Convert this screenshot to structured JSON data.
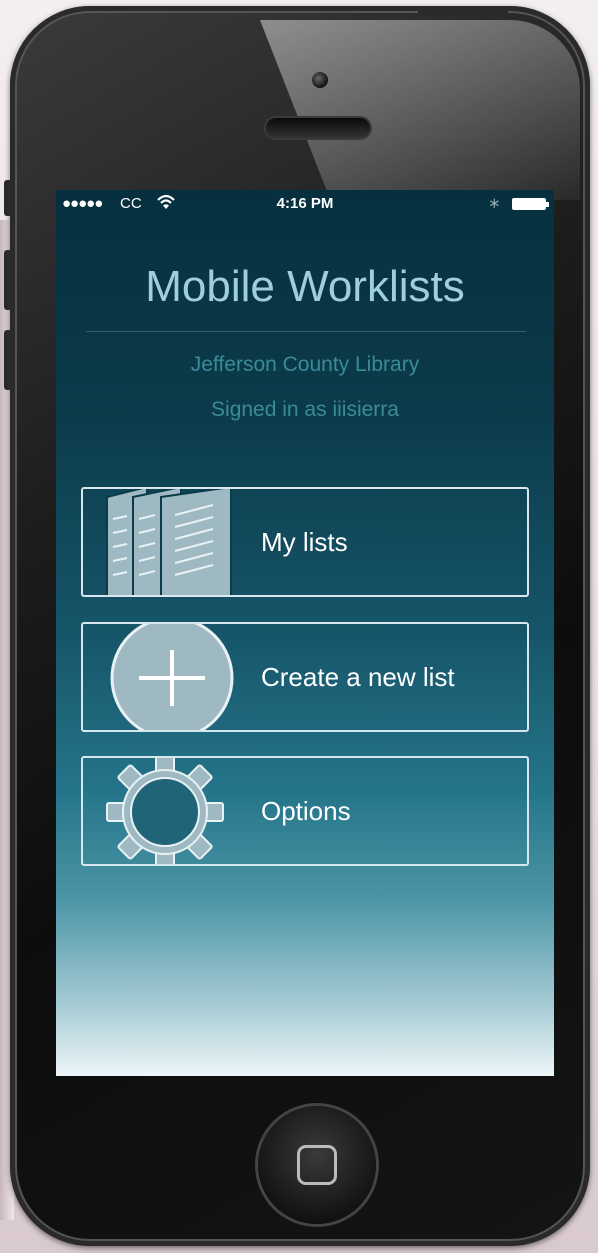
{
  "status_bar": {
    "signal": "●●●●●",
    "carrier": "CC",
    "time": "4:16 PM",
    "wifi_icon": "wifi-icon",
    "bluetooth_icon": "bluetooth-icon",
    "bluetooth_glyph": "∗",
    "battery_icon": "battery-icon"
  },
  "header": {
    "title": "Mobile Worklists",
    "library": "Jefferson County Library",
    "signed_in": "Signed in as iiisierra"
  },
  "menu": {
    "items": [
      {
        "label": "My lists",
        "icon": "documents-icon"
      },
      {
        "label": "Create a new list",
        "icon": "plus-circle-icon"
      },
      {
        "label": "Options",
        "icon": "gear-icon"
      }
    ]
  },
  "colors": {
    "screen_top": "#06303f",
    "screen_bottom": "#eef6f8",
    "title_text": "#9fd0d9",
    "subtitle_text": "#3a8b99",
    "button_border": "#d7e7ec",
    "icon_fill": "#9fb9c2"
  }
}
